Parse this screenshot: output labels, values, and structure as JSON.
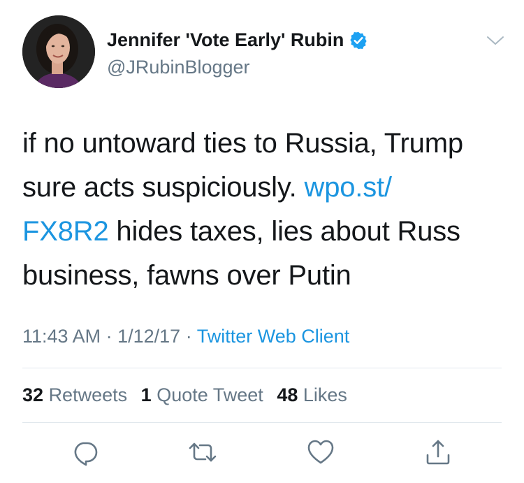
{
  "author": {
    "display_name": "Jennifer 'Vote Early' Rubin",
    "handle": "@JRubinBlogger",
    "verified": true,
    "verified_icon": "verified-badge-icon",
    "verified_color": "#1da1f2"
  },
  "tweet": {
    "lines": [
      {
        "text": "if no untoward ties to Russia, Trump",
        "link": ""
      },
      {
        "text": "sure acts suspiciously. ",
        "link": "wpo.st/"
      },
      {
        "link": "FX8R2",
        "text": " hides taxes, lies about Russ"
      },
      {
        "text": "business, fawns over Putin",
        "link": ""
      }
    ],
    "link_color": "#1b95e0"
  },
  "meta": {
    "time": "11:43 AM",
    "separator": "·",
    "date": "1/12/17",
    "client": "Twitter Web Client"
  },
  "stats": {
    "retweets_count": "32",
    "retweets_label": "Retweets",
    "quotes_count": "1",
    "quotes_label": "Quote Tweet",
    "likes_count": "48",
    "likes_label": "Likes"
  },
  "actions": [
    {
      "name": "reply",
      "icon": "reply-icon"
    },
    {
      "name": "retweet",
      "icon": "retweet-icon"
    },
    {
      "name": "like",
      "icon": "heart-icon"
    },
    {
      "name": "share",
      "icon": "share-icon"
    }
  ],
  "colors": {
    "text": "#14171a",
    "secondary": "#657786",
    "divider": "#e1e8ed"
  }
}
